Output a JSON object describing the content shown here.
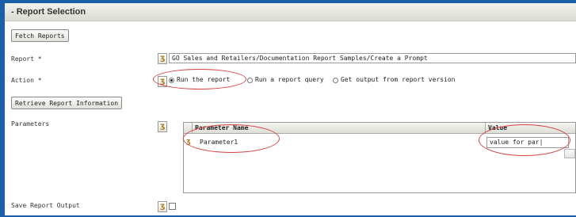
{
  "section": {
    "title": "- Report Selection"
  },
  "buttons": {
    "fetch_reports": "Fetch Reports",
    "retrieve_info": "Retrieve Report Information"
  },
  "labels": {
    "report": "Report *",
    "action": "Action *",
    "parameters": "Parameters",
    "save_output": "Save Report Output"
  },
  "report": {
    "value": "GO Sales and Retailers/Documentation Report Samples/Create a Prompt"
  },
  "action": {
    "options": [
      {
        "label": "Run the report",
        "selected": true
      },
      {
        "label": "Run a report query",
        "selected": false
      },
      {
        "label": "Get output from report version",
        "selected": false
      }
    ]
  },
  "parameters_grid": {
    "columns": [
      "Parameter Name",
      "Value"
    ],
    "rows": [
      {
        "name": "Parameter1",
        "value": "value for par|"
      }
    ]
  },
  "save_output": {
    "checked": false
  },
  "icons": {
    "prompt": "prompt-icon",
    "row": "row-edit-icon"
  },
  "colors": {
    "background": "#1a5fa8",
    "annotation": "#d84040"
  }
}
